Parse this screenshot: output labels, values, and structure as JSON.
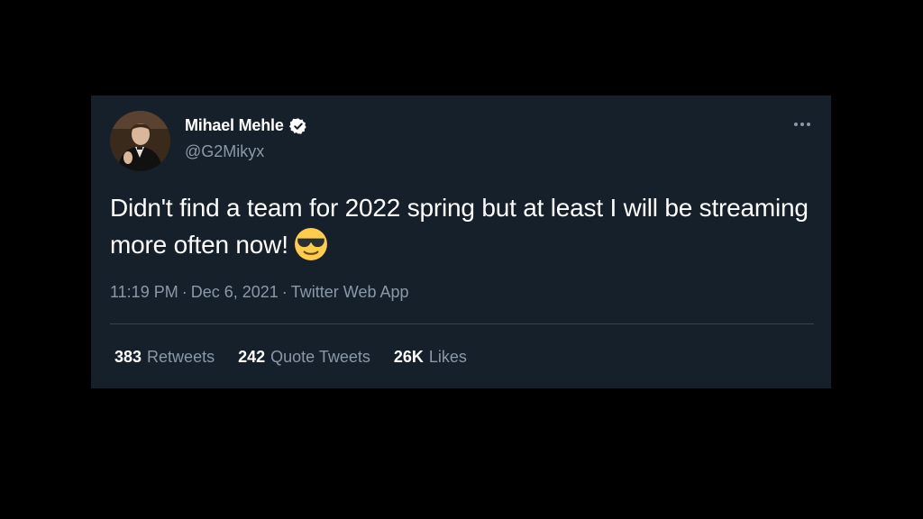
{
  "tweet": {
    "author": {
      "display_name": "Mihael Mehle",
      "handle": "@G2Mikyx",
      "verified": true
    },
    "text": "Didn't find a team for 2022 spring but at least I will be streaming more often now!",
    "emoji": "smiling-face-with-sunglasses",
    "time": "11:19 PM",
    "separator": "·",
    "date": "Dec 6, 2021",
    "source": "Twitter Web App",
    "stats": {
      "retweets": {
        "count": "383",
        "label": "Retweets"
      },
      "quote_tweets": {
        "count": "242",
        "label": "Quote Tweets"
      },
      "likes": {
        "count": "26K",
        "label": "Likes"
      }
    }
  },
  "colors": {
    "page_background": "#000000",
    "card_background": "#15202b",
    "primary_text": "#ffffff",
    "secondary_text": "#8b98a5",
    "divider": "#38444d",
    "verified_badge": "#ffffff"
  }
}
